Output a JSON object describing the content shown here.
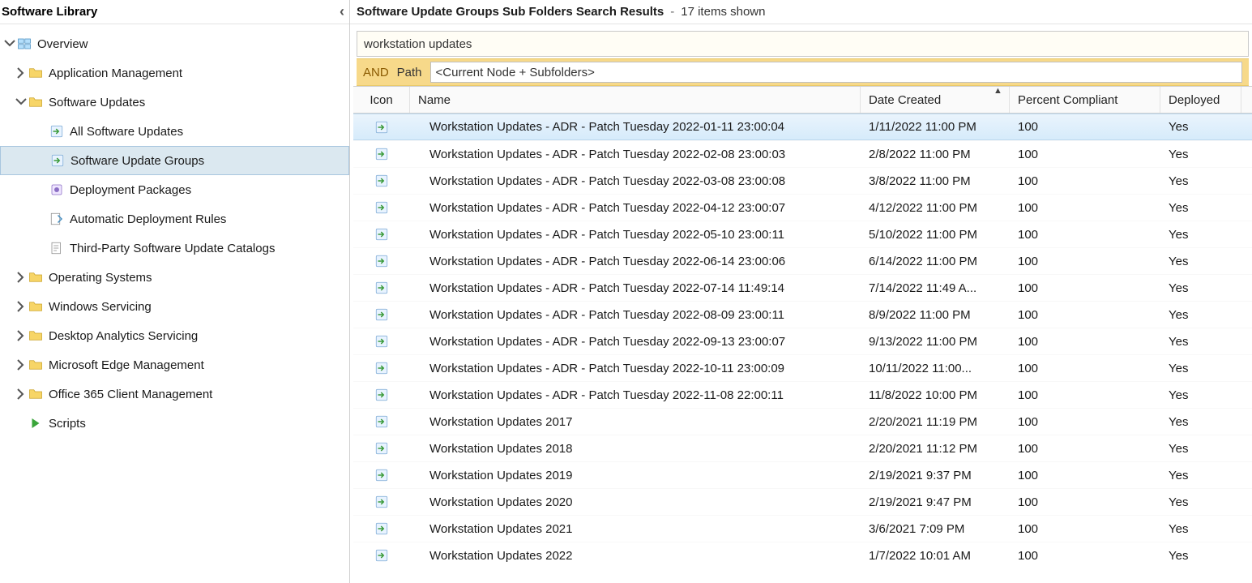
{
  "nav": {
    "title": "Software Library",
    "root": "Overview",
    "nodes": {
      "app_mgmt": "Application Management",
      "sw_updates": "Software Updates",
      "all_sw_updates": "All Software Updates",
      "sw_update_groups": "Software Update Groups",
      "deploy_pkgs": "Deployment Packages",
      "adr": "Automatic Deployment Rules",
      "third_party": "Third-Party Software Update Catalogs",
      "os": "Operating Systems",
      "win_svc": "Windows Servicing",
      "desk_analytics": "Desktop Analytics Servicing",
      "edge": "Microsoft Edge Management",
      "o365": "Office 365 Client Management",
      "scripts": "Scripts"
    }
  },
  "header": {
    "title": "Software Update Groups Sub Folders Search Results",
    "separator": "-",
    "count_text": "17 items shown"
  },
  "search": {
    "value": "workstation updates"
  },
  "filter": {
    "and_label": "AND",
    "path_label": "Path",
    "path_value": "<Current Node + Subfolders>"
  },
  "columns": {
    "icon": "Icon",
    "name": "Name",
    "date": "Date Created",
    "pct": "Percent Compliant",
    "dep": "Deployed"
  },
  "rows": [
    {
      "name": "Workstation Updates - ADR - Patch Tuesday 2022-01-11 23:00:04",
      "date": "1/11/2022 11:00 PM",
      "pct": "100",
      "dep": "Yes",
      "selected": true
    },
    {
      "name": "Workstation Updates - ADR - Patch Tuesday 2022-02-08 23:00:03",
      "date": "2/8/2022 11:00 PM",
      "pct": "100",
      "dep": "Yes"
    },
    {
      "name": "Workstation Updates - ADR - Patch Tuesday 2022-03-08 23:00:08",
      "date": "3/8/2022 11:00 PM",
      "pct": "100",
      "dep": "Yes"
    },
    {
      "name": "Workstation Updates - ADR - Patch Tuesday 2022-04-12 23:00:07",
      "date": "4/12/2022 11:00 PM",
      "pct": "100",
      "dep": "Yes"
    },
    {
      "name": "Workstation Updates - ADR - Patch Tuesday 2022-05-10 23:00:11",
      "date": "5/10/2022 11:00 PM",
      "pct": "100",
      "dep": "Yes"
    },
    {
      "name": "Workstation Updates - ADR - Patch Tuesday 2022-06-14 23:00:06",
      "date": "6/14/2022 11:00 PM",
      "pct": "100",
      "dep": "Yes"
    },
    {
      "name": "Workstation Updates - ADR - Patch Tuesday 2022-07-14 11:49:14",
      "date": "7/14/2022 11:49 A...",
      "pct": "100",
      "dep": "Yes"
    },
    {
      "name": "Workstation Updates - ADR - Patch Tuesday 2022-08-09 23:00:11",
      "date": "8/9/2022 11:00 PM",
      "pct": "100",
      "dep": "Yes"
    },
    {
      "name": "Workstation Updates - ADR - Patch Tuesday 2022-09-13 23:00:07",
      "date": "9/13/2022 11:00 PM",
      "pct": "100",
      "dep": "Yes"
    },
    {
      "name": "Workstation Updates - ADR - Patch Tuesday 2022-10-11 23:00:09",
      "date": "10/11/2022 11:00...",
      "pct": "100",
      "dep": "Yes"
    },
    {
      "name": "Workstation Updates - ADR - Patch Tuesday 2022-11-08 22:00:11",
      "date": "11/8/2022 10:00 PM",
      "pct": "100",
      "dep": "Yes"
    },
    {
      "name": "Workstation Updates 2017",
      "date": "2/20/2021 11:19 PM",
      "pct": "100",
      "dep": "Yes"
    },
    {
      "name": "Workstation Updates 2018",
      "date": "2/20/2021 11:12 PM",
      "pct": "100",
      "dep": "Yes"
    },
    {
      "name": "Workstation Updates 2019",
      "date": "2/19/2021 9:37 PM",
      "pct": "100",
      "dep": "Yes"
    },
    {
      "name": "Workstation Updates 2020",
      "date": "2/19/2021 9:47 PM",
      "pct": "100",
      "dep": "Yes"
    },
    {
      "name": "Workstation Updates 2021",
      "date": "3/6/2021 7:09 PM",
      "pct": "100",
      "dep": "Yes"
    },
    {
      "name": "Workstation Updates 2022",
      "date": "1/7/2022 10:01 AM",
      "pct": "100",
      "dep": "Yes"
    }
  ]
}
